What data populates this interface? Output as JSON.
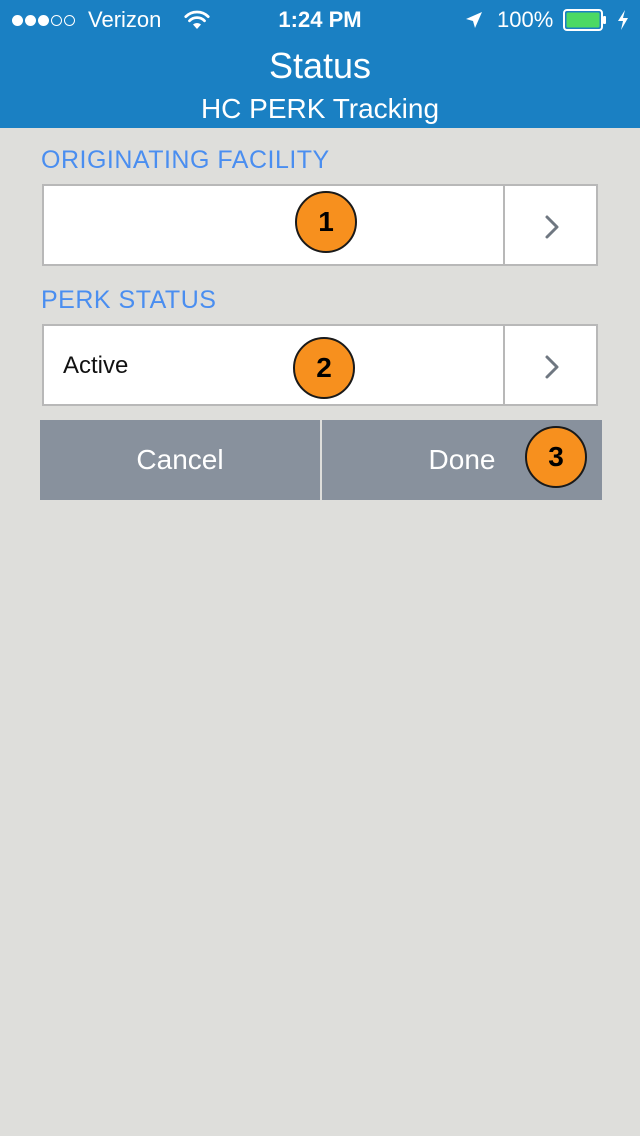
{
  "status_bar": {
    "carrier": "Verizon",
    "signal_bars_filled": 3,
    "signal_bars_total": 5,
    "time": "1:24 PM",
    "battery_percent": "100%",
    "battery_color": "#4cd964"
  },
  "nav": {
    "title": "Status",
    "subtitle": "HC PERK Tracking",
    "bar_color": "#1a80c3"
  },
  "form": {
    "originating_facility": {
      "label": "ORIGINATING FACILITY",
      "value": "",
      "badge": "1"
    },
    "perk_status": {
      "label": "PERK STATUS",
      "value": "Active",
      "badge": "2"
    }
  },
  "actions": {
    "cancel_label": "Cancel",
    "done_label": "Done",
    "done_badge": "3"
  },
  "colors": {
    "section_label": "#4a8ef0",
    "button": "#88919d",
    "badge": "#f7901e",
    "background": "#dededb"
  }
}
